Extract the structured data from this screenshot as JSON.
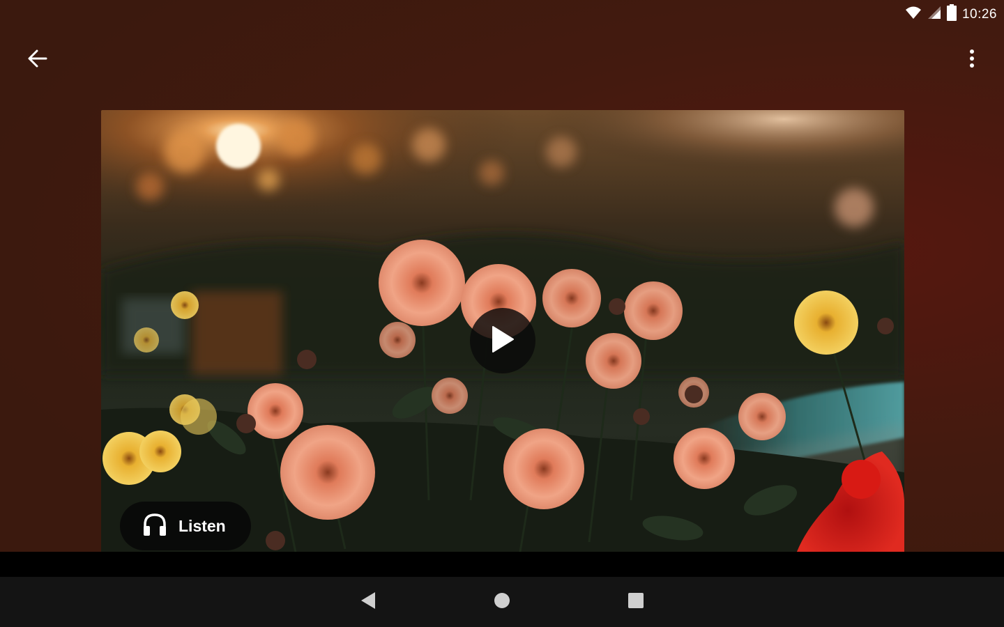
{
  "status_bar": {
    "time": "10:26",
    "icons": [
      "wifi-icon",
      "cellular-signal-icon",
      "battery-icon"
    ]
  },
  "app_bar": {
    "back_icon": "arrow-back-icon",
    "overflow_icon": "more-vertical-icon"
  },
  "media": {
    "play_icon": "play-icon",
    "listen_label": "Listen",
    "listen_icon": "headphones-icon"
  },
  "nav_bar": {
    "icons": [
      "nav-back-icon",
      "nav-home-icon",
      "nav-recents-icon"
    ]
  },
  "colors": {
    "background": "#3b190e",
    "nav_bar": "#141414",
    "overlay": "#0a0a0a",
    "text": "#ffffff"
  }
}
